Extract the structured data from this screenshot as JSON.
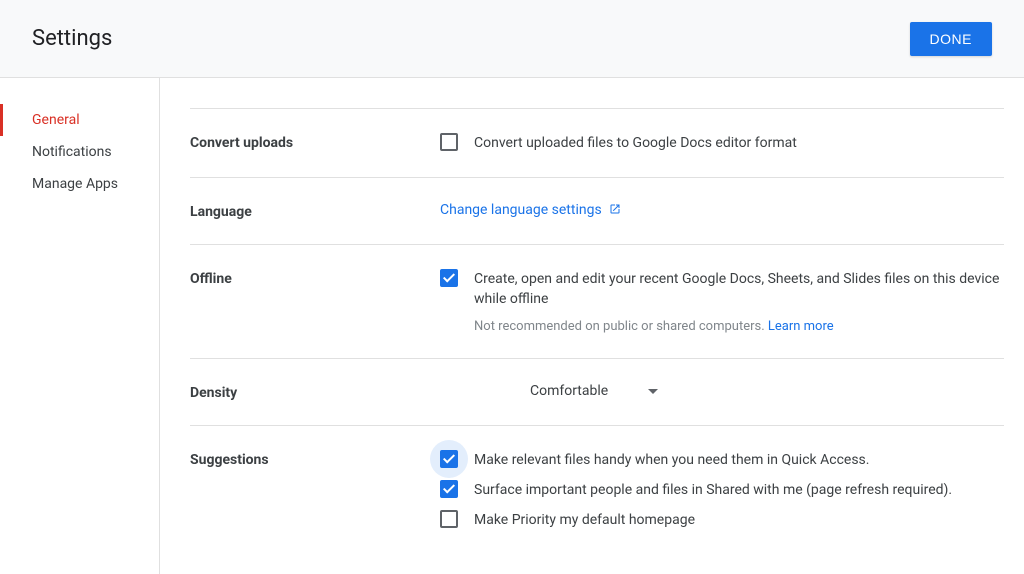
{
  "header": {
    "title": "Settings",
    "done_label": "DONE"
  },
  "sidebar": {
    "items": [
      {
        "label": "General",
        "active": true
      },
      {
        "label": "Notifications",
        "active": false
      },
      {
        "label": "Manage Apps",
        "active": false
      }
    ]
  },
  "sections": {
    "convert": {
      "label": "Convert uploads",
      "checkbox_label": "Convert uploaded files to Google Docs editor format",
      "checked": false
    },
    "language": {
      "label": "Language",
      "link_text": "Change language settings"
    },
    "offline": {
      "label": "Offline",
      "checkbox_label": "Create, open and edit your recent Google Docs, Sheets, and Slides files on this device while offline",
      "checked": true,
      "hint_prefix": "Not recommended on public or shared computers. ",
      "hint_link": "Learn more"
    },
    "density": {
      "label": "Density",
      "value": "Comfortable"
    },
    "suggestions": {
      "label": "Suggestions",
      "items": [
        {
          "label": "Make relevant files handy when you need them in Quick Access.",
          "checked": true,
          "halo": true
        },
        {
          "label": "Surface important people and files in Shared with me (page refresh required).",
          "checked": true,
          "halo": false
        },
        {
          "label": "Make Priority my default homepage",
          "checked": false,
          "halo": false
        }
      ]
    }
  }
}
